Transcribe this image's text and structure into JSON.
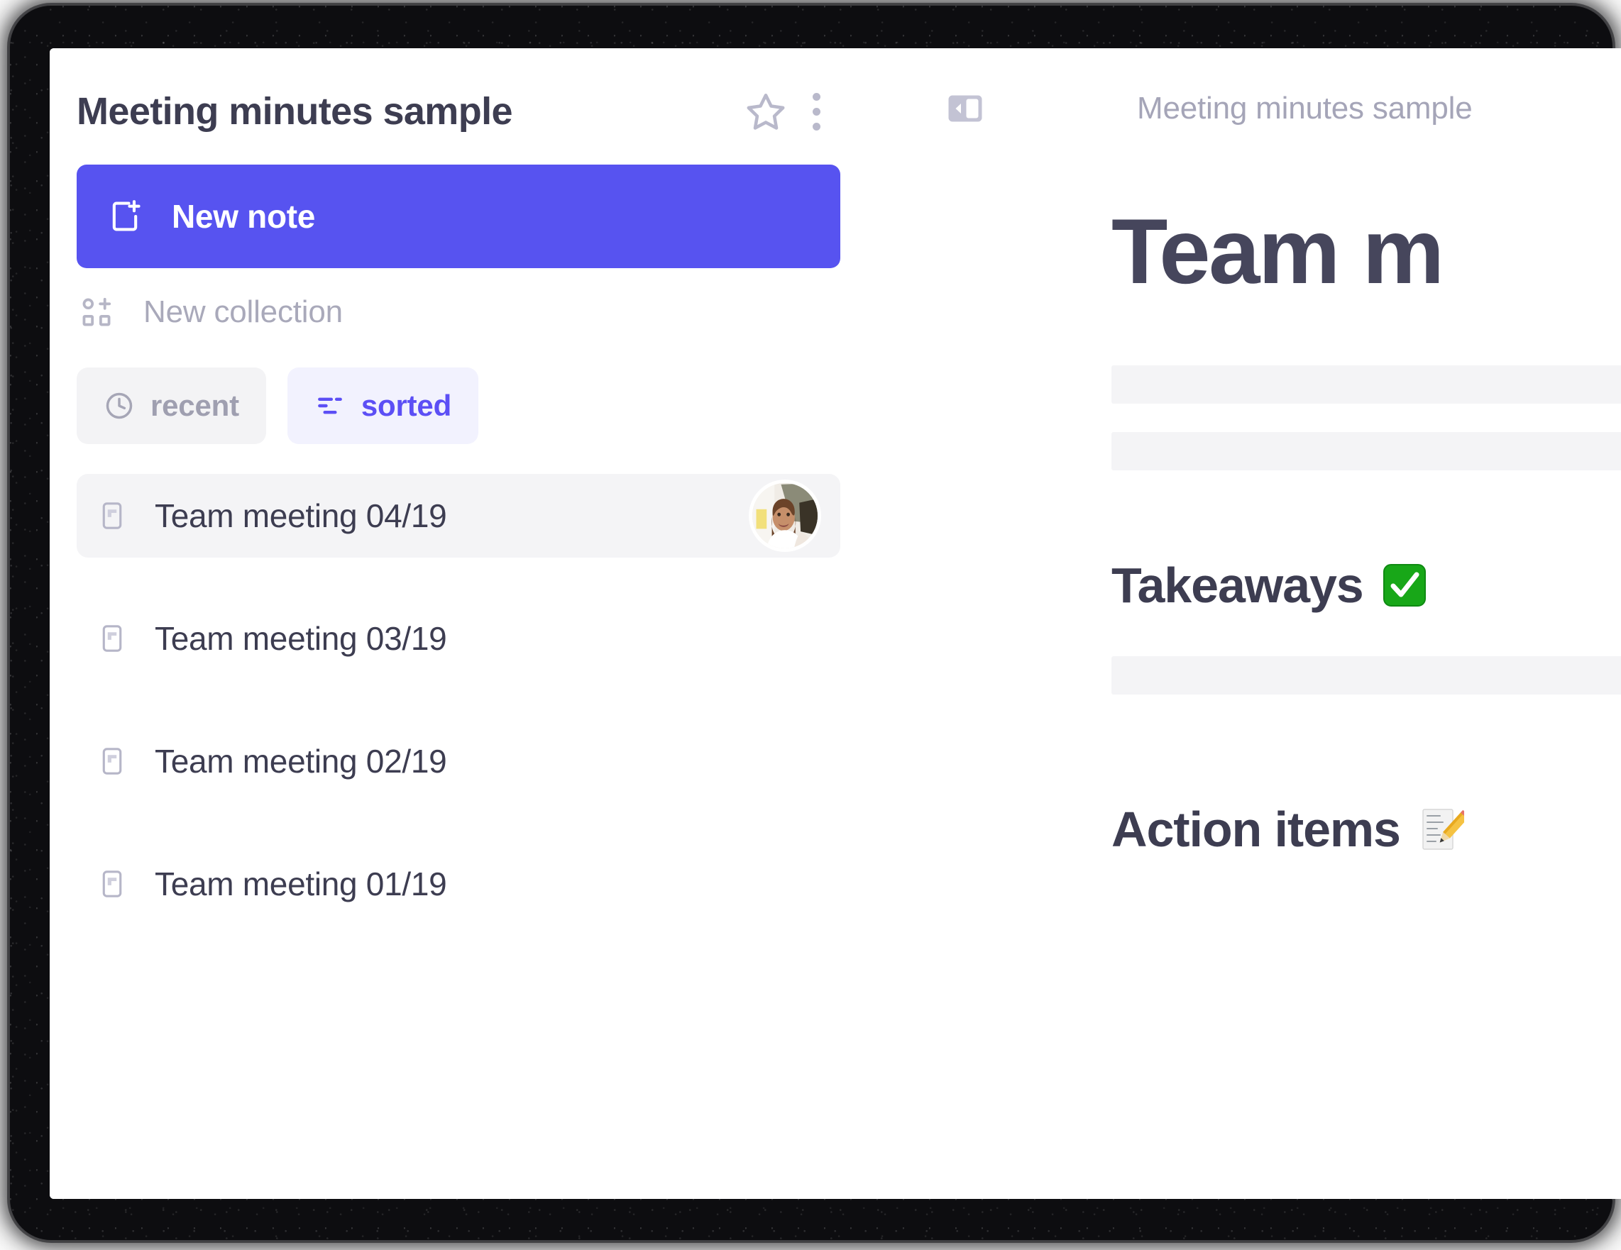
{
  "window": {
    "bezel_color": "#0d0d10",
    "card_background": "#ffffff"
  },
  "colors": {
    "accent_purple": "#5753f0",
    "accent_purple_text": "#5c4ff5",
    "chip_sorted_bg": "#f2f2fe",
    "chip_recent_bg": "#f3f3f5",
    "text_dark": "#3d3d51",
    "text_muted": "#a9a9ba",
    "skeleton": "#f4f4f6",
    "divider": "#ececf1"
  },
  "sidebar": {
    "title": "Meeting minutes sample",
    "header_icons": [
      {
        "name": "star-icon",
        "label": "Favorite"
      },
      {
        "name": "more-vertical-icon",
        "label": "More options"
      }
    ],
    "new_note_button": {
      "label": "New note",
      "icon": "note-plus-icon"
    },
    "new_collection_button": {
      "label": "New collection",
      "icon": "collection-plus-icon"
    },
    "filters": [
      {
        "label": "recent",
        "icon": "clock-icon",
        "active": false
      },
      {
        "label": "sorted",
        "icon": "sort-icon",
        "active": true
      }
    ],
    "notes": [
      {
        "label": "Team meeting 04/19",
        "icon": "note-icon",
        "selected": true,
        "avatar": "user-photo"
      },
      {
        "label": "Team meeting 03/19",
        "icon": "note-icon",
        "selected": false,
        "avatar": null
      },
      {
        "label": "Team meeting 02/19",
        "icon": "note-icon",
        "selected": false,
        "avatar": null
      },
      {
        "label": "Team meeting 01/19",
        "icon": "note-icon",
        "selected": false,
        "avatar": null
      }
    ]
  },
  "document": {
    "collapse_button": {
      "name": "collapse-sidebar-icon",
      "label": "Collapse sidebar"
    },
    "breadcrumb": "Meeting minutes sample",
    "title": "Team m",
    "sections": [
      {
        "heading": "Takeaways",
        "emoji": "check-mark-button"
      },
      {
        "heading": "Action items",
        "emoji": "memo"
      }
    ]
  }
}
